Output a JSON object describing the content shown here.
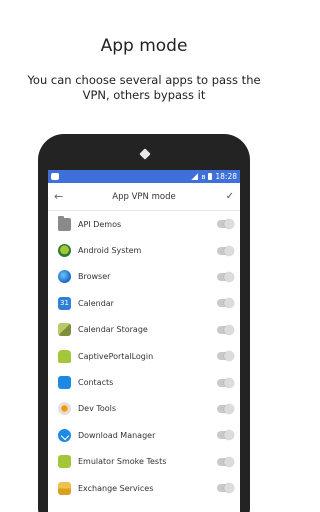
{
  "promo": {
    "title": "App mode",
    "subtitle": "You can choose several apps to pass the VPN, others bypass it"
  },
  "status_bar": {
    "time": "18:28",
    "bluetooth_icon": "ʙ"
  },
  "app_bar": {
    "back_icon": "←",
    "title": "App VPN mode",
    "check_icon": "✓"
  },
  "colors": {
    "accent": "#3f6fd8",
    "toggle_off": "#c9c9c9"
  },
  "apps": [
    {
      "label": "API Demos",
      "icon": "folder-icon",
      "enabled": false
    },
    {
      "label": "Android System",
      "icon": "android-system-icon",
      "enabled": false
    },
    {
      "label": "Browser",
      "icon": "globe-icon",
      "enabled": false
    },
    {
      "label": "Calendar",
      "icon": "calendar-icon",
      "enabled": false
    },
    {
      "label": "Calendar Storage",
      "icon": "calendar-storage-icon",
      "enabled": false
    },
    {
      "label": "CaptivePortalLogin",
      "icon": "android-icon",
      "enabled": false
    },
    {
      "label": "Contacts",
      "icon": "contacts-icon",
      "enabled": false
    },
    {
      "label": "Dev Tools",
      "icon": "gear-icon",
      "enabled": false
    },
    {
      "label": "Download Manager",
      "icon": "download-icon",
      "enabled": false
    },
    {
      "label": "Emulator Smoke Tests",
      "icon": "android-icon",
      "enabled": false
    },
    {
      "label": "Exchange Services",
      "icon": "mail-icon",
      "enabled": false
    }
  ]
}
